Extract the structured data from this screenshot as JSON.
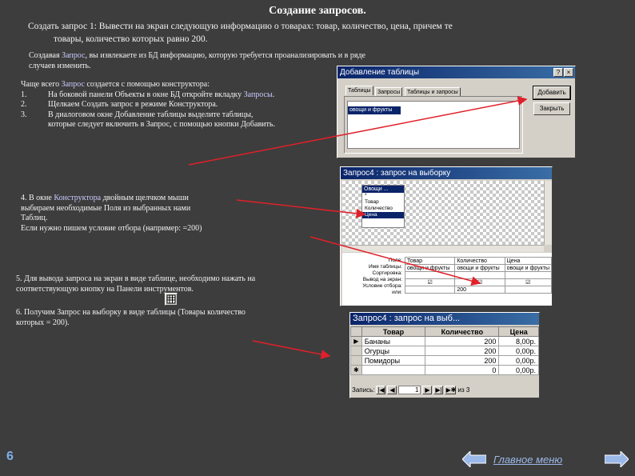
{
  "slide": {
    "title": "Создание запросов.",
    "task_line1": "Создать запрос 1: Вывести на экран следующую информацию о товарах: товар, количество, цена, причем те",
    "task_line2": "товары, количество которых равно 200.",
    "intro_a": "Создавая ",
    "intro_hl": "Запрос",
    "intro_b": ", вы извлекаете из БД информацию, которую требуется проанализировать и в ряде",
    "intro_line2": "случаев изменить.",
    "steps_header_a": "Чаще всего ",
    "steps_header_hl": "Запрос",
    "steps_header_b": " создается с помощью конструктора:",
    "step1_num": "1.",
    "step1_a": "На боковой панели Объекты в окне БД откройте вкладку ",
    "step1_hl": "Запросы",
    "step1_b": ".",
    "step2_num": "2.",
    "step2": "Щелкаем Создать запрос в режиме Конструктора.",
    "step3_num": "3.",
    "step3_line1": "В диалоговом окне Добавление таблицы выделите таблицы,",
    "step3_line2": "которые следует включить в Запрос, с помощью кнопки Добавить.",
    "step4_a": "4. В окне ",
    "step4_hl": "Конструктора",
    "step4_b": " двойным щелчком мыши",
    "step4_line2": "выбираем  необходимые Поля из выбранных нами",
    "step4_line3": "Таблиц.",
    "step4_line4a": "Если нужно пишем условие отбора (например: ",
    "step4_line4b": "=200)",
    "step5_line1": "5. Для вывода запроса на экран в виде таблице, необходимо нажать на",
    "step5_line2": "соответствующую кнопку на Панели инструментов.",
    "step6_line1": "6. Получим Запрос на выборку в виде таблицы (Товары количество",
    "step6_line2a": "которых  ",
    "step6_line2b": "= 200).",
    "page_number": "6",
    "main_menu": "Главное меню"
  },
  "add_table_dialog": {
    "title": "Добавление таблицы",
    "help": "?",
    "close": "×",
    "tabs": [
      "Таблицы",
      "Запросы",
      "Таблицы и запросы"
    ],
    "list_item": "овощи и фрукты",
    "add_button": "Добавить",
    "close_button": "Закрыть"
  },
  "designer": {
    "title": "Запрос4 : запрос на выборку",
    "field_list_title": "Овощи ...",
    "fields": [
      "*",
      "Товар",
      "Количество",
      "Цена"
    ],
    "row_labels": [
      "Поле:",
      "Имя таблицы:",
      "Сортировка:",
      "Вывод на экран:",
      "Условие отбора:",
      "или:"
    ],
    "columns": [
      {
        "field": "Товар",
        "table": "овощи и фрукты",
        "show": "☑",
        "criteria": ""
      },
      {
        "field": "Количество",
        "table": "овощи и фрукты",
        "show": "☑",
        "criteria": "200"
      },
      {
        "field": "Цена",
        "table": "овощи и фрукты",
        "show": "☑",
        "criteria": ""
      }
    ]
  },
  "toolbar_icon": "datasheet-view-icon",
  "result": {
    "title": "Запрос4 : запрос на выб...",
    "headers": [
      "Товар",
      "Количество",
      "Цена"
    ],
    "rows": [
      {
        "marker": "▶",
        "item": "Бананы",
        "qty": "200",
        "price": "8,00р."
      },
      {
        "marker": "",
        "item": "Огурцы",
        "qty": "200",
        "price": "0,00р."
      },
      {
        "marker": "",
        "item": "Помидоры",
        "qty": "200",
        "price": "0,00р."
      },
      {
        "marker": "✱",
        "item": "",
        "qty": "0",
        "price": "0,00р."
      }
    ],
    "record_label": "Запись:",
    "record_current": "1",
    "record_of": "из 3"
  },
  "colors": {
    "background": "#3d3d3d",
    "arrow": "#e0202a",
    "highlight_text": "#c9c9ff"
  }
}
